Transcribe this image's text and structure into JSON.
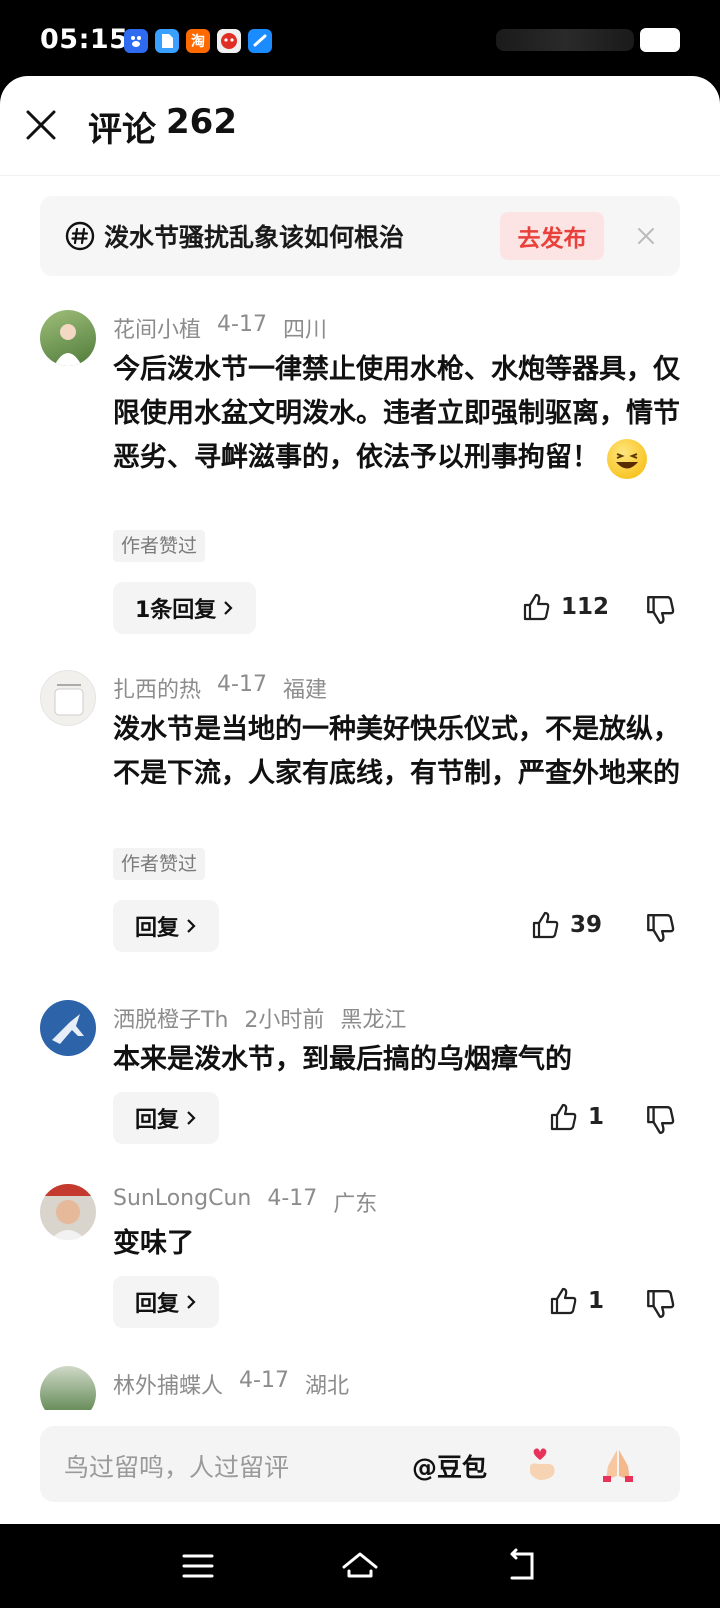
{
  "status_bar": {
    "time": "05:15"
  },
  "header": {
    "title": "评论",
    "count": "262"
  },
  "topic": {
    "text": "泼水节骚扰乱象该如何根治",
    "publish_label": "去发布"
  },
  "comments": [
    {
      "user": "花间小植",
      "date": "4-17",
      "location": "四川",
      "text": "今后泼水节一律禁止使用水枪、水炮等器具，仅限使用水盆文明泼水。违者立即强制驱离，情节恶劣、寻衅滋事的，依法予以刑事拘留！",
      "tag": "作者赞过",
      "reply_label": "1条回复",
      "likes": "112"
    },
    {
      "user": "扎西的热",
      "date": "4-17",
      "location": "福建",
      "text": "泼水节是当地的一种美好快乐仪式，不是放纵，不是下流，人家有底线，有节制，严查外地来的",
      "tag": "作者赞过",
      "reply_label": "回复",
      "likes": "39"
    },
    {
      "user": "洒脱橙子Th",
      "date": "2小时前",
      "location": "黑龙江",
      "text": "本来是泼水节，到最后搞的乌烟瘴气的",
      "reply_label": "回复",
      "likes": "1"
    },
    {
      "user": "SunLongCun",
      "date": "4-17",
      "location": "广东",
      "text": "变味了",
      "reply_label": "回复",
      "likes": "1"
    },
    {
      "user": "林外捕蝶人",
      "date": "4-17",
      "location": "湖北"
    }
  ],
  "input": {
    "placeholder": "鸟过留鸣，人过留评",
    "mention": "@豆包"
  },
  "colors": {
    "accent": "#e8413b",
    "accent_bg": "#fde4e4"
  },
  "icons": [
    "close-icon",
    "hashtag-icon",
    "thumbs-up-icon",
    "thumbs-down-icon",
    "chevron-right-icon",
    "finger-heart-icon",
    "pray-icon",
    "menu-icon",
    "home-icon",
    "back-icon"
  ]
}
